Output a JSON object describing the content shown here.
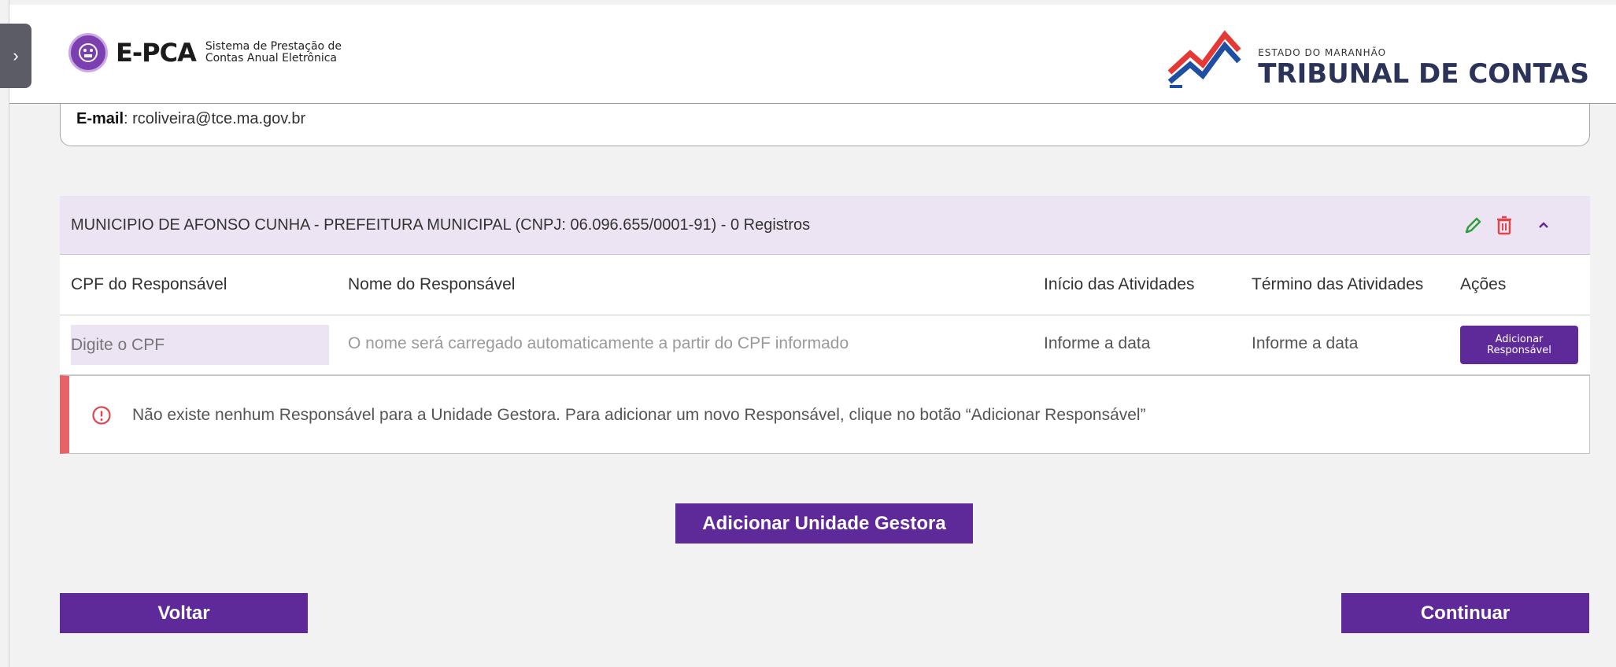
{
  "header": {
    "app_logo_text": "E-PCA",
    "app_subtitle_line1": "Sistema de Prestação de",
    "app_subtitle_line2": "Contas Anual Eletrônica",
    "org_small": "ESTADO DO MARANHÃO",
    "org_big": "TRIBUNAL DE CONTAS"
  },
  "info": {
    "email_label": "E-mail",
    "email_value": ": rcoliveira@tce.ma.gov.br"
  },
  "section": {
    "title": "MUNICIPIO DE AFONSO CUNHA - PREFEITURA MUNICIPAL (CNPJ: 06.096.655/0001-91) - 0 Registros"
  },
  "table": {
    "columns": [
      "CPF do Responsável",
      "Nome do Responsável",
      "Início das Atividades",
      "Término das Atividades",
      "Ações"
    ],
    "row": {
      "cpf_placeholder": "Digite o CPF",
      "name_hint": "O nome será carregado automaticamente a partir do CPF informado",
      "start_date": "Informe a data",
      "end_date": "Informe a data",
      "add_button_line1": "Adicionar",
      "add_button_line2": "Responsável"
    }
  },
  "alert": {
    "message": "Não existe nenhum Responsável para a Unidade Gestora. Para adicionar um novo Responsável, clique no botão “Adicionar Responsável”"
  },
  "actions": {
    "add_unit": "Adicionar Unidade Gestora",
    "back": "Voltar",
    "continue": "Continuar"
  },
  "colors": {
    "primary": "#5e2a9a",
    "section_bg": "#ece4f3",
    "alert_accent": "#e66468",
    "edit_icon": "#2e9e3e",
    "delete_icon": "#e0474c"
  }
}
